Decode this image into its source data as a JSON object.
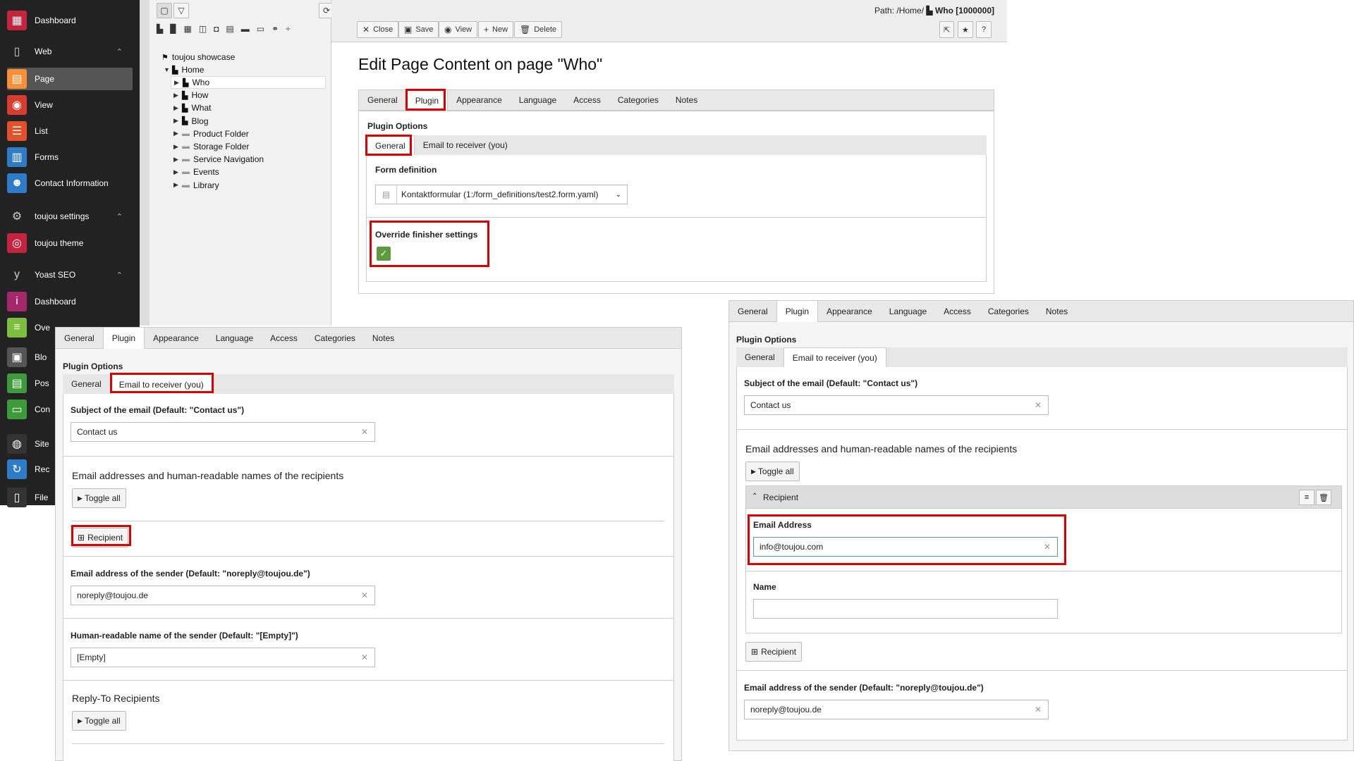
{
  "sidebar": {
    "items": [
      {
        "label": "Dashboard",
        "icon": "dashboard-icon",
        "color": "#c4233e"
      },
      {
        "label": "Web",
        "icon": "web-icon",
        "group": true
      },
      {
        "label": "Page",
        "icon": "page-icon",
        "color": "#f68e3a",
        "active": true
      },
      {
        "label": "View",
        "icon": "eye-icon",
        "color": "#d83c2e"
      },
      {
        "label": "List",
        "icon": "list-icon",
        "color": "#e0522b"
      },
      {
        "label": "Forms",
        "icon": "forms-icon",
        "color": "#2f7cc6"
      },
      {
        "label": "Contact Information",
        "icon": "contact-icon",
        "color": "#2f7cc6"
      },
      {
        "label": "toujou settings",
        "icon": "gear-icon",
        "group": true
      },
      {
        "label": "toujou theme",
        "icon": "fingerprint-icon",
        "color": "#c4233e"
      },
      {
        "label": "Yoast SEO",
        "icon": "yoast-icon",
        "group": true
      },
      {
        "label": "Dashboard",
        "icon": "info-icon",
        "color": "#a4286a"
      },
      {
        "label": "Ove",
        "icon": "overview-icon",
        "color": "#7cbf3f"
      },
      {
        "label": "Blo",
        "icon": "blog-icon",
        "color": "#555"
      },
      {
        "label": "Pos",
        "icon": "post-icon",
        "color": "#3d9b3c"
      },
      {
        "label": "Con",
        "icon": "content-icon",
        "color": "#3d9b3c"
      },
      {
        "label": "Site",
        "icon": "globe-icon",
        "color": "#333"
      },
      {
        "label": "Rec",
        "icon": "refresh-icon",
        "color": "#2f7cc6"
      },
      {
        "label": "File",
        "icon": "file-icon",
        "color": "#333"
      }
    ]
  },
  "tree": {
    "root": "toujou showcase",
    "home": "Home",
    "children": [
      "Who",
      "How",
      "What",
      "Blog",
      "Product Folder",
      "Storage Folder",
      "Service Navigation",
      "Events",
      "Library"
    ]
  },
  "docheader": {
    "path_prefix": "Path: /Home/",
    "path_page": "Who [1000000]",
    "buttons": {
      "close": "Close",
      "save": "Save",
      "view": "View",
      "new": "New",
      "delete": "Delete"
    }
  },
  "main": {
    "title": "Edit Page Content on page \"Who\"",
    "tabs": [
      "General",
      "Plugin",
      "Appearance",
      "Language",
      "Access",
      "Categories",
      "Notes"
    ],
    "plugin_options": "Plugin Options",
    "subtabs": [
      "General",
      "Email to receiver (you)"
    ],
    "form_definition_label": "Form definition",
    "form_definition_value": "Kontaktformular (1:/form_definitions/test2.form.yaml)",
    "override_label": "Override finisher settings"
  },
  "panel_left": {
    "subject_label": "Subject of the email (Default: \"Contact us\")",
    "subject_value": "Contact us",
    "recipients_title": "Email addresses and human-readable names of the recipients",
    "toggle_all": "Toggle all",
    "recipient_btn": "Recipient",
    "sender_email_label": "Email address of the sender (Default: \"noreply@toujou.de\")",
    "sender_email_value": "noreply@toujou.de",
    "sender_name_label": "Human-readable name of the sender (Default: \"[Empty]\")",
    "sender_name_value": "[Empty]",
    "replyto_title": "Reply-To Recipients",
    "toggle_all_2": "Toggle all"
  },
  "panel_right": {
    "subject_label": "Subject of the email (Default: \"Contact us\")",
    "subject_value": "Contact us",
    "recipients_title": "Email addresses and human-readable names of the recipients",
    "toggle_all": "Toggle all",
    "recipient_header": "Recipient",
    "email_label": "Email Address",
    "email_value": "info@toujou.com",
    "name_label": "Name",
    "name_value": "",
    "recipient_btn": "Recipient",
    "sender_email_label": "Email address of the sender (Default: \"noreply@toujou.de\")",
    "sender_email_value": "noreply@toujou.de"
  }
}
